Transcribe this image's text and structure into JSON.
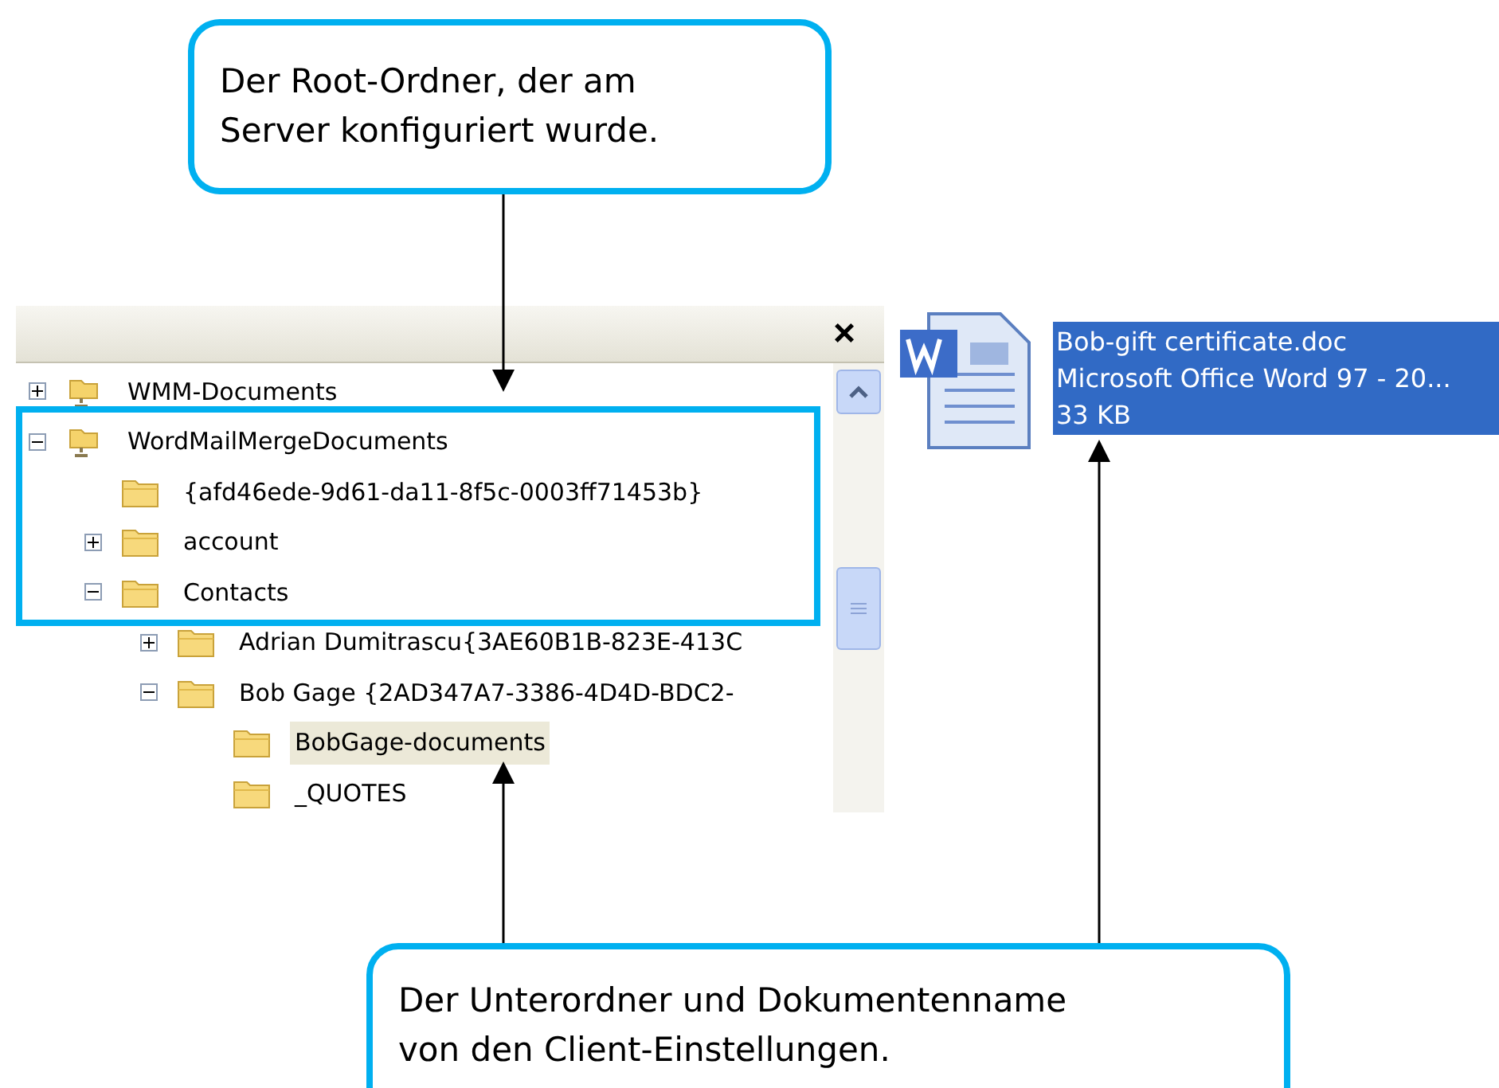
{
  "callouts": [
    {
      "lines": [
        "Der Root-Ordner, der am",
        "Server konfiguriert wurde."
      ]
    },
    {
      "lines": [
        "Der Unterordner und Dokumentenname",
        "von den Client-Einstellungen."
      ]
    }
  ],
  "tree_panel": {
    "close": "×",
    "items": [
      {
        "label": "WMM-Documents",
        "kind": "shared",
        "expanded": false,
        "selected": false
      },
      {
        "label": "WordMailMergeDocuments",
        "kind": "shared",
        "expanded": true,
        "selected": false,
        "children": [
          {
            "label": "{afd46ede-9d61-da11-8f5c-0003ff71453b}",
            "kind": "folder",
            "selected": false
          },
          {
            "label": "account",
            "kind": "folder",
            "expanded": false,
            "selected": false
          },
          {
            "label": "Contacts",
            "kind": "folder",
            "expanded": true,
            "selected": false,
            "children": [
              {
                "label": "Adrian Dumitrascu{3AE60B1B-823E-413C",
                "kind": "folder",
                "expanded": false,
                "selected": false
              },
              {
                "label": "Bob Gage {2AD347A7-3386-4D4D-BDC2-",
                "kind": "folder",
                "expanded": true,
                "selected": false,
                "children": [
                  {
                    "label": "BobGage-documents",
                    "kind": "folder",
                    "selected": true
                  },
                  {
                    "label": "_QUOTES",
                    "kind": "folder",
                    "selected": false
                  }
                ]
              }
            ]
          }
        ]
      }
    ]
  },
  "file": {
    "name": "Bob-gift certificate.doc",
    "type": "Microsoft Office Word 97 - 20...",
    "size": "33 KB",
    "selected": true
  }
}
